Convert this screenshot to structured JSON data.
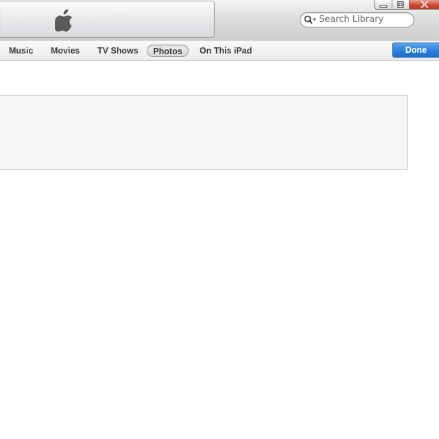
{
  "window": {
    "controls": {
      "minimize_icon": "minimize-icon",
      "maximize_icon": "restore-icon",
      "close_icon": "close-icon"
    }
  },
  "header": {
    "logo_icon": "apple-logo-icon"
  },
  "search": {
    "placeholder": "Search Library",
    "value": ""
  },
  "nav": {
    "tabs": [
      {
        "label": "Music"
      },
      {
        "label": "Movies"
      },
      {
        "label": "TV Shows"
      },
      {
        "label": "Photos",
        "selected": true
      },
      {
        "label": "On This iPad"
      }
    ],
    "done_label": "Done"
  },
  "colors": {
    "done_button": "#2b7fd9",
    "close_button": "#c9452e",
    "panel_background": "#f6f6f6"
  }
}
